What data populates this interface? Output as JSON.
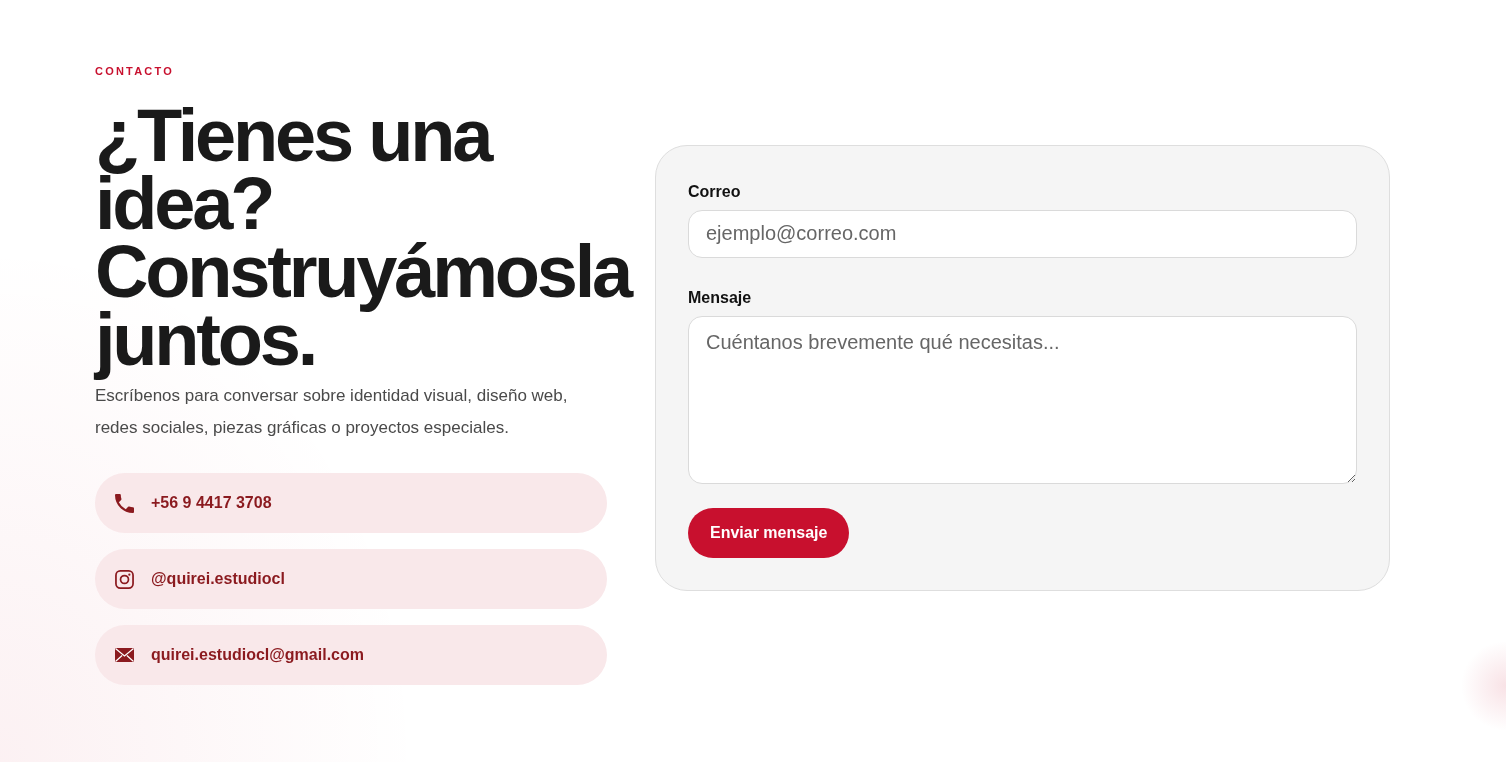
{
  "section": {
    "eyebrow": "CONTACTO",
    "heading": "¿Tienes una idea? Construyámosla juntos.",
    "intro": "Escríbenos para conversar sobre identidad visual, diseño web, redes sociales, piezas gráficas o proyectos especiales."
  },
  "contacts": [
    {
      "kind": "phone",
      "text": "+56 9 4417 3708"
    },
    {
      "kind": "instagram",
      "text": "@quirei.estudiocl"
    },
    {
      "kind": "email",
      "text": "quirei.estudiocl@gmail.com"
    }
  ],
  "form": {
    "fields": [
      {
        "kind": "input",
        "label": "Correo",
        "placeholder": "ejemplo@correo.com"
      },
      {
        "kind": "textarea",
        "label": "Mensaje",
        "placeholder": "Cuéntanos brevemente qué necesitas..."
      }
    ],
    "submit": "Enviar mensaje"
  }
}
